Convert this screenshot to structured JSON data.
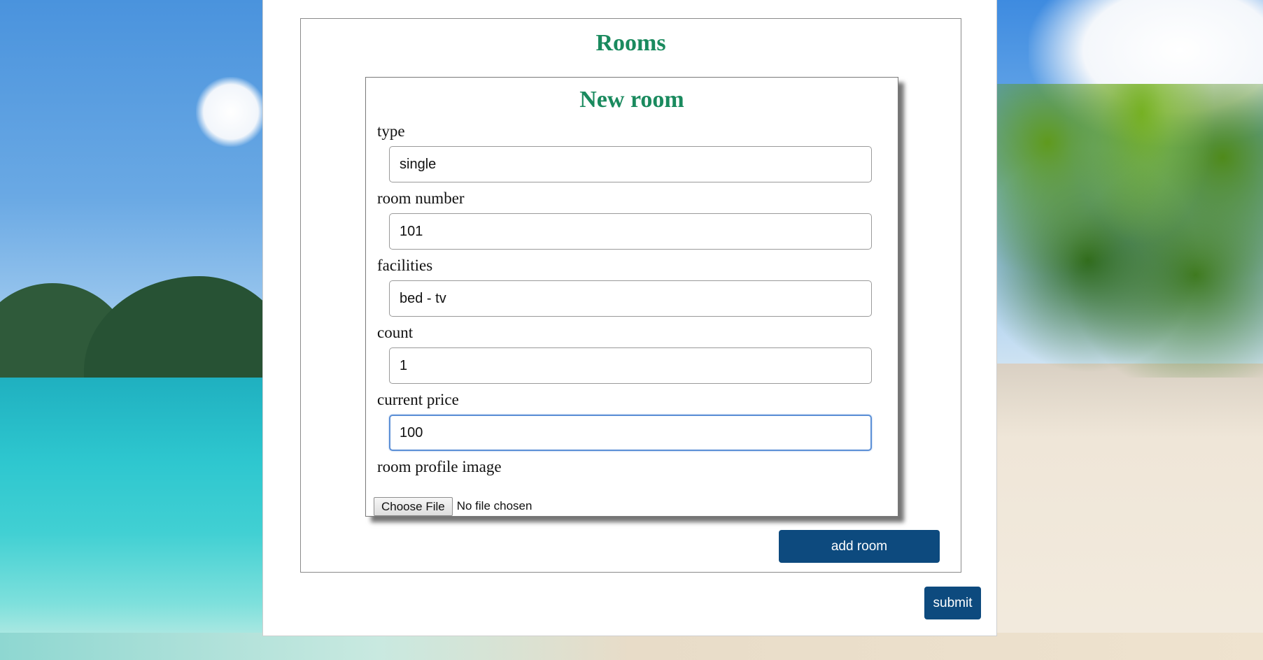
{
  "page": {
    "title": "Rooms"
  },
  "form": {
    "title": "New room",
    "fields": [
      {
        "label": "type",
        "value": "single"
      },
      {
        "label": "room number",
        "value": "101"
      },
      {
        "label": "facilities",
        "value": "bed - tv"
      },
      {
        "label": "count",
        "value": "1"
      },
      {
        "label": "current price",
        "value": "100"
      }
    ],
    "image": {
      "label": "room profile image",
      "button_label": "Choose File",
      "status": "No file chosen"
    }
  },
  "actions": {
    "add_room_label": "add room",
    "submit_label": "submit"
  },
  "colors": {
    "title_green": "#1a8a5e",
    "button_blue": "#0d4a7e",
    "focus_blue": "#5b8fd6"
  }
}
